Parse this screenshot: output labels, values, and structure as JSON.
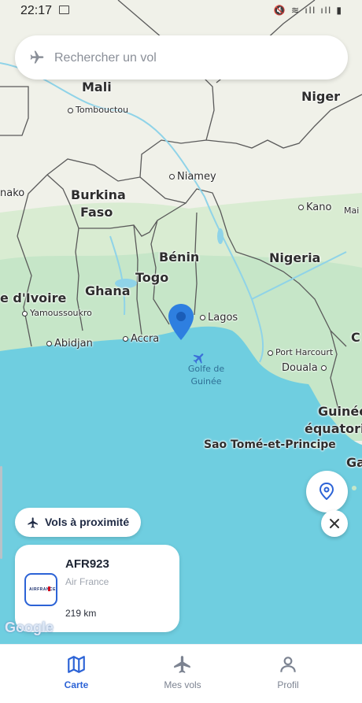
{
  "status_bar": {
    "time": "22:17",
    "right_icons": "🔇 ≋ ıll ıll ▮"
  },
  "search": {
    "placeholder": "Rechercher un vol"
  },
  "map": {
    "labels": {
      "mali": "Mali",
      "tombouctou": "Tombouctou",
      "niger": "Niger",
      "niamey": "Niamey",
      "burkina": "Burkina",
      "faso": "Faso",
      "kano": "Kano",
      "mai": "Mai",
      "nako": "nako",
      "benin": "Bénin",
      "nigeria": "Nigeria",
      "togo": "Togo",
      "ghana": "Ghana",
      "cote_ivoire": "e d'Ivoire",
      "yamoussoukro": "Yamoussoukro",
      "lagos": "Lagos",
      "abidjan": "Abidjan",
      "accra": "Accra",
      "c": "C",
      "port_harcourt": "Port Harcourt",
      "douala": "Douala",
      "golfe_line1": "Golfe de",
      "golfe_line2": "Guinée",
      "guinee_line1": "Guinée",
      "guinee_line2": "équatoria",
      "sao_tome": "Sao Tomé-et-Principe",
      "ga": "Ga"
    },
    "attribution": "Google"
  },
  "nearby_chip": {
    "label": "Vols à proximité"
  },
  "flight_card": {
    "code": "AFR923",
    "airline": "Air France",
    "distance": "219 km",
    "logo_text": "AIRFRANCE"
  },
  "nav": {
    "items": [
      {
        "label": "Carte",
        "icon": "map-icon"
      },
      {
        "label": "Mes vols",
        "icon": "plane-icon"
      },
      {
        "label": "Profil",
        "icon": "person-icon"
      }
    ],
    "active": "Carte"
  },
  "colors": {
    "land": "#eef0e6",
    "forest": "#c5e6c9",
    "sea": "#6fcee0",
    "accent": "#2c63d6",
    "pin": "#2e7fe0"
  }
}
